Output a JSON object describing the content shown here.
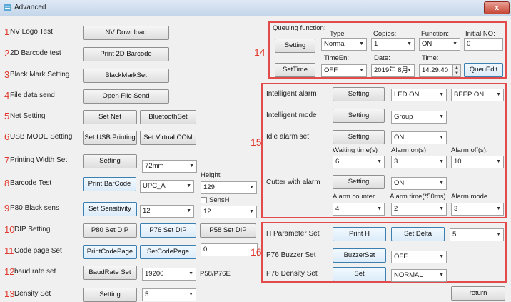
{
  "window": {
    "title": "Advanced",
    "close_glyph": "x"
  },
  "left": {
    "rows": [
      {
        "num": "1",
        "label": "NV Logo Test",
        "buttons": [
          "NV Download"
        ]
      },
      {
        "num": "2",
        "label": "2D Barcode test",
        "buttons": [
          "Print 2D Barcode"
        ]
      },
      {
        "num": "3",
        "label": "Black Mark Setting",
        "buttons": [
          "BlackMarkSet"
        ]
      },
      {
        "num": "4",
        "label": "File data send",
        "buttons": [
          "Open File Send"
        ]
      },
      {
        "num": "5",
        "label": "Net Setting",
        "buttons": [
          "Set Net",
          "BluetoothSet"
        ]
      },
      {
        "num": "6",
        "label": "USB MODE Setting",
        "buttons": [
          "Set USB Printing",
          "Set Virtual COM"
        ]
      },
      {
        "num": "7",
        "label": "Printing Width Set",
        "buttons": [
          "Setting"
        ]
      },
      {
        "num": "8",
        "label": "Barcode Test",
        "buttons": [
          "Print BarCode"
        ]
      },
      {
        "num": "9",
        "label": "P80 Black sens",
        "buttons": [
          "Set Sensitivity"
        ]
      },
      {
        "num": "10",
        "label": "DIP Setting",
        "buttons": [
          "P80 Set DIP",
          "P76 Set DIP",
          "P58 Set DIP"
        ]
      },
      {
        "num": "11",
        "label": "Code page Set",
        "buttons": [
          "PrintCodePage",
          "SetCodePage"
        ]
      },
      {
        "num": "12",
        "label": "baud rate set",
        "buttons": [
          "BaudRate Set"
        ]
      },
      {
        "num": "13",
        "label": "Density Set",
        "buttons": [
          "Setting"
        ]
      }
    ],
    "width_select": "72mm",
    "barcode_type_select": "UPC_A",
    "height_label": "Height",
    "height_select": "129",
    "sensitivity_select": "12",
    "sensh_label": "SensH",
    "sensh_select": "12",
    "codepage_value": "0",
    "baud_select": "19200",
    "baud_note": "P58/P76E",
    "density_select": "5"
  },
  "group14": {
    "num": "14",
    "queuing_label": "Queuing function:",
    "setting_button": "Setting",
    "settime_button": "SetTime",
    "type_label": "Type",
    "type_value": "Normal",
    "copies_label": "Copies:",
    "copies_value": "1",
    "function_label": "Function:",
    "function_value": "ON",
    "initial_label": "Initial NO:",
    "initial_value": "0",
    "timeen_label": "TimeEn:",
    "timeen_value": "OFF",
    "date_label": "Date:",
    "date_value": "2019年 8月",
    "time_label": "Time:",
    "time_value": "14:29:40",
    "queuedit_button": "QueuEdit"
  },
  "group15": {
    "num": "15",
    "intelligent_alarm_label": "Intelligent alarm",
    "intelligent_alarm_button": "Setting",
    "led_value": "LED ON",
    "beep_value": "BEEP ON",
    "intelligent_mode_label": "Intelligent mode",
    "intelligent_mode_button": "Setting",
    "group_value": "Group",
    "idle_alarm_label": "Idle alarm set",
    "idle_alarm_button": "Setting",
    "idle_value": "ON",
    "waiting_label": "Waiting time(s)",
    "waiting_value": "6",
    "alarm_on_label": "Alarm on(s):",
    "alarm_on_value": "3",
    "alarm_off_label": "Alarm off(s):",
    "alarm_off_value": "10",
    "cutter_label": "Cutter with alarm",
    "cutter_button": "Setting",
    "cutter_value": "ON",
    "alarm_counter_label": "Alarm counter",
    "alarm_counter_value": "4",
    "alarm_time_label": "Alarm time(*50ms)",
    "alarm_time_value": "2",
    "alarm_mode_label": "Alarm mode",
    "alarm_mode_value": "3"
  },
  "group16": {
    "num": "16",
    "hparam_label": "H Parameter Set",
    "print_h_button": "Print H",
    "set_delta_button": "Set Delta",
    "delta_value": "5",
    "buzzer_label": "P76 Buzzer Set",
    "buzzer_button": "BuzzerSet",
    "buzzer_value": "OFF",
    "density_label": "P76 Density Set",
    "density_button": "Set",
    "density_value": "NORMAL"
  },
  "return_button": "return",
  "colors": {
    "accent_red": "#e14b4b",
    "number_red": "#e23a2e",
    "button_blue": "#3c7fb1"
  }
}
